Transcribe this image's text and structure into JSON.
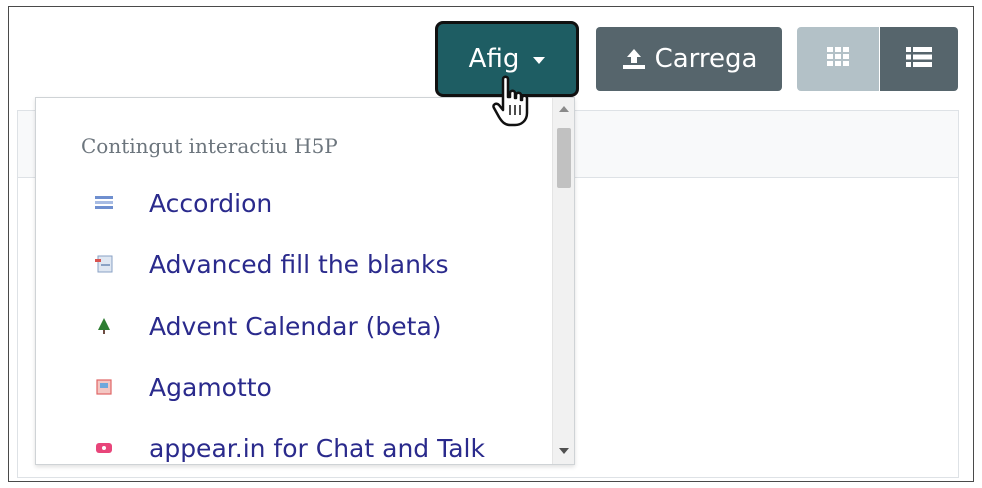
{
  "toolbar": {
    "add_label": "Afig",
    "upload_label": "Carrega",
    "grid_icon": "grid-view-icon",
    "list_icon": "list-view-icon"
  },
  "dropdown": {
    "header": "Contingut interactiu H5P",
    "items": [
      {
        "label": "Accordion",
        "icon": "accordion-icon",
        "color": "#5b7fbf"
      },
      {
        "label": "Advanced fill the blanks",
        "icon": "fill-blanks-icon",
        "color": "#d9534f"
      },
      {
        "label": "Advent Calendar (beta)",
        "icon": "tree-icon",
        "color": "#2e7d32"
      },
      {
        "label": "Agamotto",
        "icon": "image-sequence-icon",
        "color": "#e06666"
      },
      {
        "label": "appear.in for Chat and Talk",
        "icon": "chat-icon",
        "color": "#e8457a"
      }
    ]
  },
  "colors": {
    "primary": "#1e5d63",
    "secondary": "#56656c",
    "toggle_inactive": "#b3c1c7",
    "link": "#2a2a8c"
  }
}
